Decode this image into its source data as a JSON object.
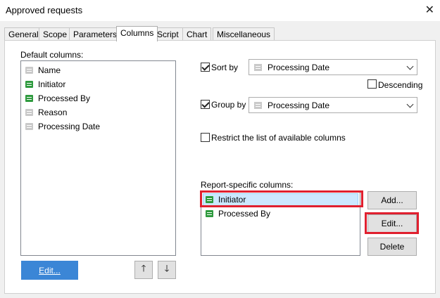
{
  "window": {
    "title": "Approved requests",
    "close": "✕"
  },
  "tabs": [
    "General",
    "Scope",
    "Parameters",
    "Columns",
    "Script",
    "Chart",
    "Miscellaneous"
  ],
  "active_tab": "Columns",
  "default_columns": {
    "label": "Default columns:",
    "items": [
      {
        "label": "Name",
        "icon": "gray"
      },
      {
        "label": "Initiator",
        "icon": "green"
      },
      {
        "label": "Processed By",
        "icon": "green"
      },
      {
        "label": "Reason",
        "icon": "gray"
      },
      {
        "label": "Processing Date",
        "icon": "gray"
      }
    ],
    "edit_label": "Edit...",
    "up_label": "🡑",
    "down_label": "🡓"
  },
  "sort": {
    "label": "Sort by",
    "checked": true,
    "value": "Processing Date",
    "descending_label": "Descending",
    "descending_checked": false
  },
  "group": {
    "label": "Group by",
    "checked": true,
    "value": "Processing Date"
  },
  "restrict": {
    "label": "Restrict the list of available columns",
    "checked": false
  },
  "report_columns": {
    "label": "Report-specific columns:",
    "items": [
      {
        "label": "Initiator",
        "icon": "green",
        "selected": true
      },
      {
        "label": "Processed By",
        "icon": "green",
        "selected": false
      }
    ],
    "add_label": "Add...",
    "edit_label": "Edit...",
    "delete_label": "Delete"
  },
  "colors": {
    "highlight": "#e0202f",
    "accent": "#3b86d6",
    "green_icon": "#2e9a3e"
  }
}
